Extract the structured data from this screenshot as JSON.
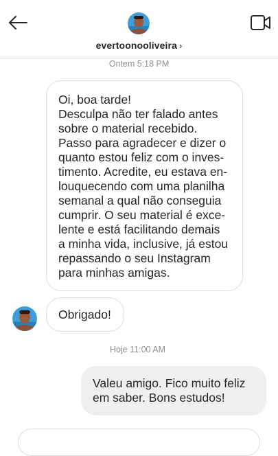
{
  "header": {
    "username": "evertoonooliveira",
    "chevron": "›",
    "icons": {
      "back": "arrow-left-icon",
      "video": "video-camera-icon"
    }
  },
  "timestamps": [
    "Ontem 5:18 PM",
    "Hoje 11:00 AM"
  ],
  "messages": [
    {
      "direction": "incoming",
      "lines": [
        "Oi, boa tarde!",
        "Desculpa não ter falado antes",
        "sobre o material recebido.",
        "Passo para agradecer e dizer o",
        "quanto estou feliz com o inves-",
        "timento. Acredite, eu estava en-",
        "louquecendo com uma planilha",
        "semanal a qual não conseguia",
        "cumprir. O seu material é exce-",
        "lente e está facilitando demais",
        "a minha vida, inclusive, já estou",
        "repassando o seu Instagram",
        "para minhas amigas."
      ]
    },
    {
      "direction": "incoming",
      "lines": [
        "Obrigado!"
      ]
    },
    {
      "direction": "outgoing",
      "lines": [
        "Valeu amigo. Fico muito feliz",
        "em saber. Bons estudos!"
      ]
    }
  ],
  "colors": {
    "incoming_border": "#dbdbdb",
    "outgoing_bg": "#efefef",
    "timestamp": "#8e8e8e",
    "text": "#262626"
  }
}
